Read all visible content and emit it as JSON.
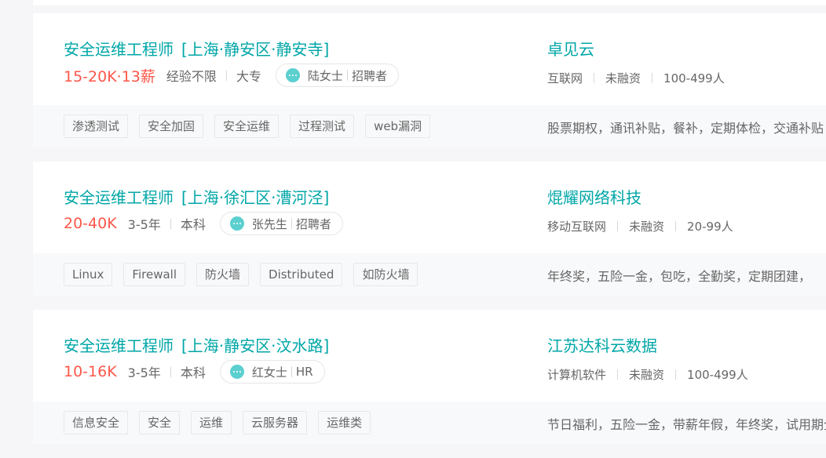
{
  "jobs": [
    {
      "title": "安全运维工程师",
      "area": "[上海·静安区·静安寺]",
      "salary": "15-20K·13薪",
      "experience": "经验不限",
      "degree": "大专",
      "recruiter_name": "陆女士",
      "recruiter_role": "招聘者",
      "company": "卓见云",
      "industry": "互联网",
      "funding": "未融资",
      "size": "100-499人",
      "tags": [
        "渗透测试",
        "安全加固",
        "安全运维",
        "过程测试",
        "web漏洞"
      ],
      "benefits": "股票期权，通讯补贴，餐补，定期体检，交通补贴"
    },
    {
      "title": "安全运维工程师",
      "area": "[上海·徐汇区·漕河泾]",
      "salary": "20-40K",
      "experience": "3-5年",
      "degree": "本科",
      "recruiter_name": "张先生",
      "recruiter_role": "招聘者",
      "company": "焜耀网络科技",
      "industry": "移动互联网",
      "funding": "未融资",
      "size": "20-99人",
      "tags": [
        "Linux",
        "Firewall",
        "防火墙",
        "Distributed",
        "如防火墙"
      ],
      "benefits": "年终奖，五险一金，包吃，全勤奖，定期团建，"
    },
    {
      "title": "安全运维工程师",
      "area": "[上海·静安区·汶水路]",
      "salary": "10-16K",
      "experience": "3-5年",
      "degree": "本科",
      "recruiter_name": "红女士",
      "recruiter_role": "HR",
      "company": "江苏达科云数据",
      "industry": "计算机软件",
      "funding": "未融资",
      "size": "100-499人",
      "tags": [
        "信息安全",
        "安全",
        "运维",
        "云服务器",
        "运维类"
      ],
      "benefits": "节日福利，五险一金，带薪年假，年终奖，试用期全薪"
    }
  ],
  "colors": {
    "accent": "#00a6a7",
    "salary": "#fe574a",
    "chat_icon": "#5ccfcf"
  }
}
